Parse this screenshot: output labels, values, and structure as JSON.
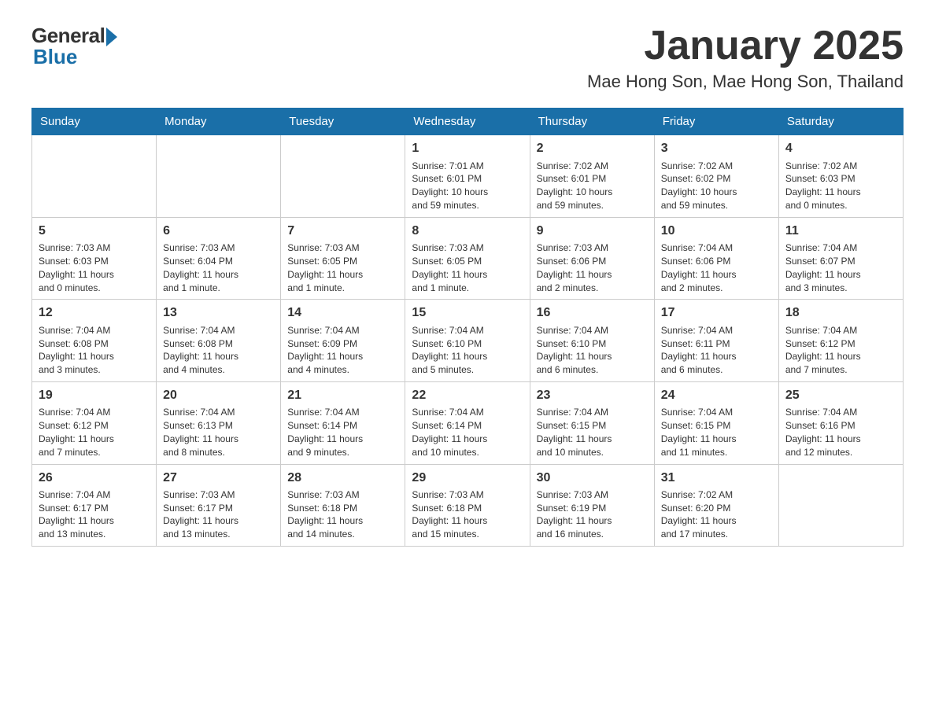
{
  "logo": {
    "general_text": "General",
    "blue_text": "Blue"
  },
  "title": "January 2025",
  "location": "Mae Hong Son, Mae Hong Son, Thailand",
  "weekdays": [
    "Sunday",
    "Monday",
    "Tuesday",
    "Wednesday",
    "Thursday",
    "Friday",
    "Saturday"
  ],
  "weeks": [
    [
      {
        "day": "",
        "info": ""
      },
      {
        "day": "",
        "info": ""
      },
      {
        "day": "",
        "info": ""
      },
      {
        "day": "1",
        "info": "Sunrise: 7:01 AM\nSunset: 6:01 PM\nDaylight: 10 hours\nand 59 minutes."
      },
      {
        "day": "2",
        "info": "Sunrise: 7:02 AM\nSunset: 6:01 PM\nDaylight: 10 hours\nand 59 minutes."
      },
      {
        "day": "3",
        "info": "Sunrise: 7:02 AM\nSunset: 6:02 PM\nDaylight: 10 hours\nand 59 minutes."
      },
      {
        "day": "4",
        "info": "Sunrise: 7:02 AM\nSunset: 6:03 PM\nDaylight: 11 hours\nand 0 minutes."
      }
    ],
    [
      {
        "day": "5",
        "info": "Sunrise: 7:03 AM\nSunset: 6:03 PM\nDaylight: 11 hours\nand 0 minutes."
      },
      {
        "day": "6",
        "info": "Sunrise: 7:03 AM\nSunset: 6:04 PM\nDaylight: 11 hours\nand 1 minute."
      },
      {
        "day": "7",
        "info": "Sunrise: 7:03 AM\nSunset: 6:05 PM\nDaylight: 11 hours\nand 1 minute."
      },
      {
        "day": "8",
        "info": "Sunrise: 7:03 AM\nSunset: 6:05 PM\nDaylight: 11 hours\nand 1 minute."
      },
      {
        "day": "9",
        "info": "Sunrise: 7:03 AM\nSunset: 6:06 PM\nDaylight: 11 hours\nand 2 minutes."
      },
      {
        "day": "10",
        "info": "Sunrise: 7:04 AM\nSunset: 6:06 PM\nDaylight: 11 hours\nand 2 minutes."
      },
      {
        "day": "11",
        "info": "Sunrise: 7:04 AM\nSunset: 6:07 PM\nDaylight: 11 hours\nand 3 minutes."
      }
    ],
    [
      {
        "day": "12",
        "info": "Sunrise: 7:04 AM\nSunset: 6:08 PM\nDaylight: 11 hours\nand 3 minutes."
      },
      {
        "day": "13",
        "info": "Sunrise: 7:04 AM\nSunset: 6:08 PM\nDaylight: 11 hours\nand 4 minutes."
      },
      {
        "day": "14",
        "info": "Sunrise: 7:04 AM\nSunset: 6:09 PM\nDaylight: 11 hours\nand 4 minutes."
      },
      {
        "day": "15",
        "info": "Sunrise: 7:04 AM\nSunset: 6:10 PM\nDaylight: 11 hours\nand 5 minutes."
      },
      {
        "day": "16",
        "info": "Sunrise: 7:04 AM\nSunset: 6:10 PM\nDaylight: 11 hours\nand 6 minutes."
      },
      {
        "day": "17",
        "info": "Sunrise: 7:04 AM\nSunset: 6:11 PM\nDaylight: 11 hours\nand 6 minutes."
      },
      {
        "day": "18",
        "info": "Sunrise: 7:04 AM\nSunset: 6:12 PM\nDaylight: 11 hours\nand 7 minutes."
      }
    ],
    [
      {
        "day": "19",
        "info": "Sunrise: 7:04 AM\nSunset: 6:12 PM\nDaylight: 11 hours\nand 7 minutes."
      },
      {
        "day": "20",
        "info": "Sunrise: 7:04 AM\nSunset: 6:13 PM\nDaylight: 11 hours\nand 8 minutes."
      },
      {
        "day": "21",
        "info": "Sunrise: 7:04 AM\nSunset: 6:14 PM\nDaylight: 11 hours\nand 9 minutes."
      },
      {
        "day": "22",
        "info": "Sunrise: 7:04 AM\nSunset: 6:14 PM\nDaylight: 11 hours\nand 10 minutes."
      },
      {
        "day": "23",
        "info": "Sunrise: 7:04 AM\nSunset: 6:15 PM\nDaylight: 11 hours\nand 10 minutes."
      },
      {
        "day": "24",
        "info": "Sunrise: 7:04 AM\nSunset: 6:15 PM\nDaylight: 11 hours\nand 11 minutes."
      },
      {
        "day": "25",
        "info": "Sunrise: 7:04 AM\nSunset: 6:16 PM\nDaylight: 11 hours\nand 12 minutes."
      }
    ],
    [
      {
        "day": "26",
        "info": "Sunrise: 7:04 AM\nSunset: 6:17 PM\nDaylight: 11 hours\nand 13 minutes."
      },
      {
        "day": "27",
        "info": "Sunrise: 7:03 AM\nSunset: 6:17 PM\nDaylight: 11 hours\nand 13 minutes."
      },
      {
        "day": "28",
        "info": "Sunrise: 7:03 AM\nSunset: 6:18 PM\nDaylight: 11 hours\nand 14 minutes."
      },
      {
        "day": "29",
        "info": "Sunrise: 7:03 AM\nSunset: 6:18 PM\nDaylight: 11 hours\nand 15 minutes."
      },
      {
        "day": "30",
        "info": "Sunrise: 7:03 AM\nSunset: 6:19 PM\nDaylight: 11 hours\nand 16 minutes."
      },
      {
        "day": "31",
        "info": "Sunrise: 7:02 AM\nSunset: 6:20 PM\nDaylight: 11 hours\nand 17 minutes."
      },
      {
        "day": "",
        "info": ""
      }
    ]
  ]
}
